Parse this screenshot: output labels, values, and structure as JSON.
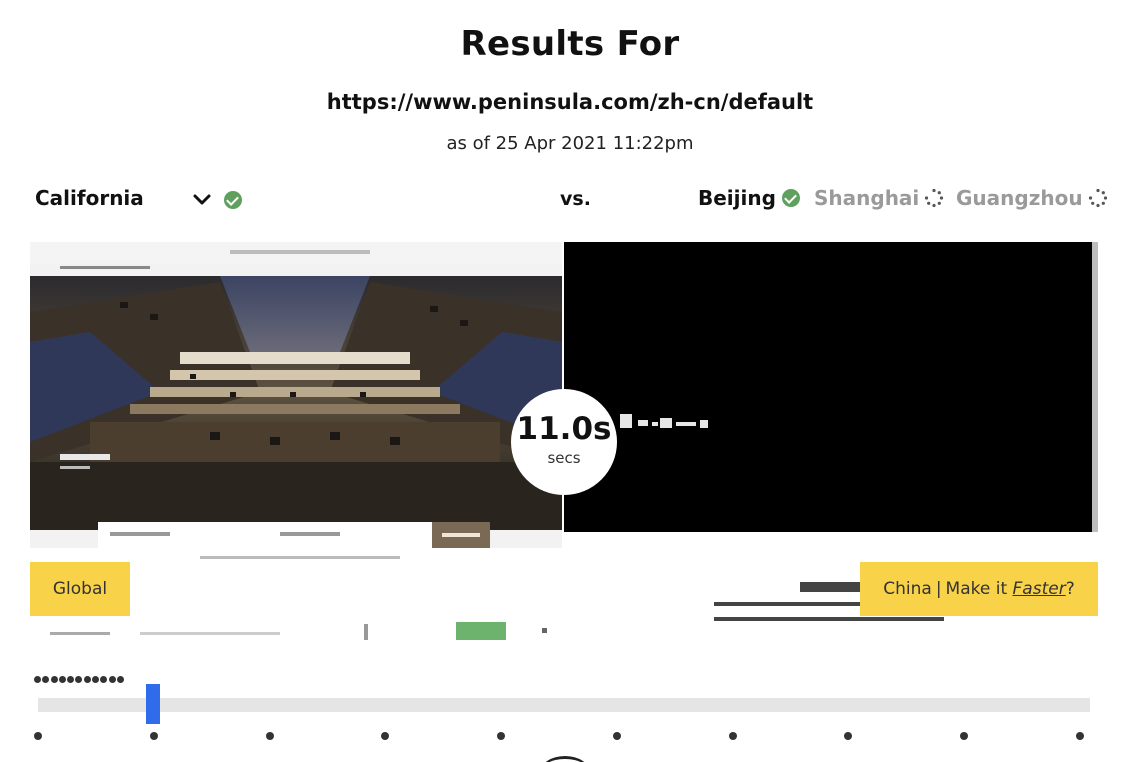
{
  "header": {
    "title": "Results For",
    "url": "https://www.peninsula.com/zh-cn/default",
    "as_of": "as of 25 Apr 2021 11:22pm"
  },
  "locations": {
    "primary": "California",
    "vs_label": "vs.",
    "compare": [
      {
        "name": "Beijing",
        "status": "complete"
      },
      {
        "name": "Shanghai",
        "status": "loading"
      },
      {
        "name": "Guangzhou",
        "status": "loading"
      }
    ]
  },
  "timer": {
    "value": "11.0s",
    "unit": "secs"
  },
  "labels": {
    "left": "Global",
    "right_prefix": "China",
    "right_separator": "|",
    "right_middle": "Make it",
    "right_link": "Faster",
    "right_suffix": "?"
  },
  "timeline": {
    "thumbnail_count": 11,
    "tick_count": 10,
    "position_fraction": 0.11
  },
  "colors": {
    "accent_yellow": "#f8d248",
    "check_green": "#5fa05f",
    "slider_blue": "#2f6bea",
    "muted_text": "#9a9a9a"
  },
  "icons": {
    "dropdown": "chevron-down-icon",
    "complete": "check-circle-icon",
    "loading": "spinner-icon"
  }
}
